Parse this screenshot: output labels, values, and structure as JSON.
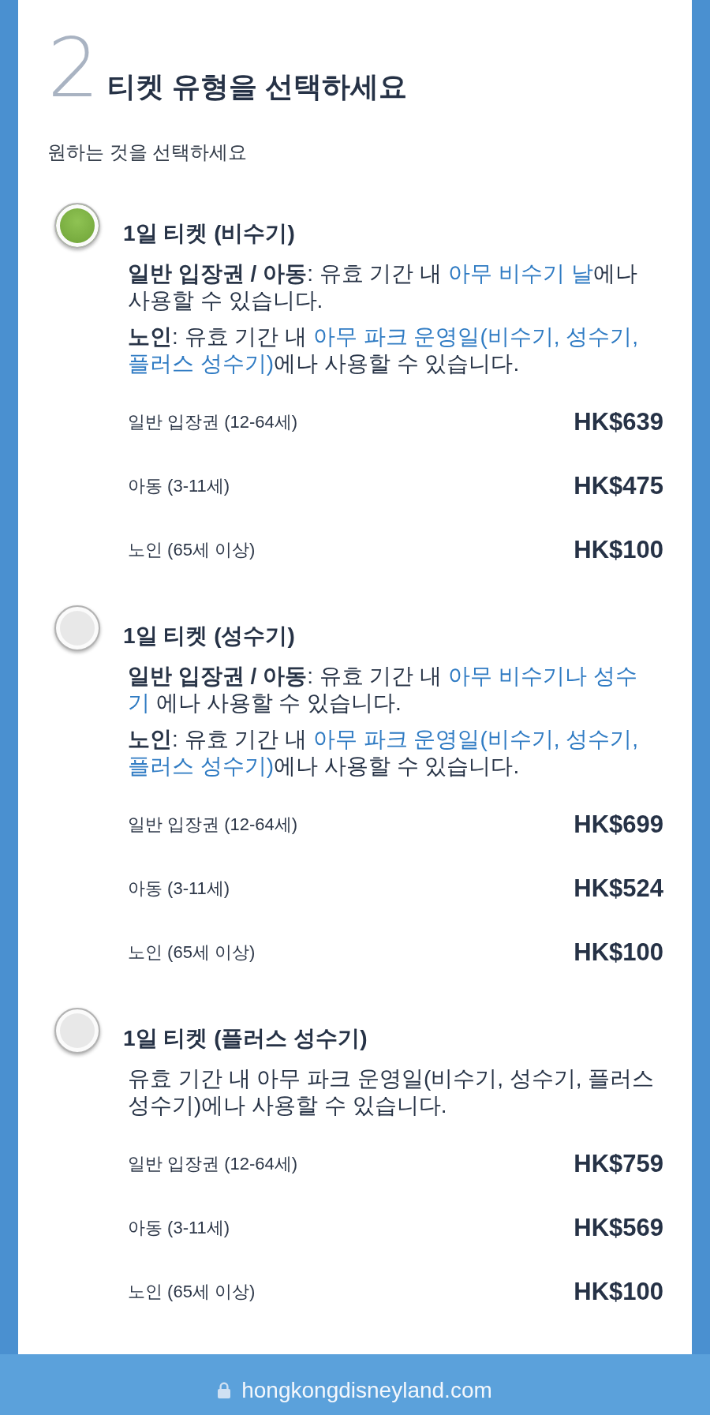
{
  "step": {
    "number": "2",
    "title": "티켓 유형을 선택하세요"
  },
  "instruction": "원하는 것을 선택하세요",
  "options": [
    {
      "title": "1일 티켓 (비수기)",
      "selected": true,
      "descriptions": [
        {
          "lines": [
            [
              {
                "kind": "text",
                "text": "**일반 입장권 / 아동**: 유효 기간 내 "
              },
              {
                "kind": "link",
                "text": "아무 비수기 날"
              },
              {
                "kind": "text",
                "text": "에나"
              }
            ],
            [
              {
                "kind": "text",
                "text": "사용할 수 있습니다."
              }
            ]
          ]
        },
        {
          "lines": [
            [
              {
                "kind": "text",
                "text": "**노인**: 유효 기간 내 "
              },
              {
                "kind": "link",
                "text": "아무 파크 운영일(비수기, 성수기,"
              }
            ],
            [
              {
                "kind": "link",
                "text": "플러스 성수기)"
              },
              {
                "kind": "text",
                "text": "에나 사용할 수 있습니다."
              }
            ]
          ]
        }
      ],
      "prices": [
        {
          "label": "일반 입장권 (12-64세)",
          "price": "HK$639"
        },
        {
          "label": "아동 (3-11세)",
          "price": "HK$475"
        },
        {
          "label": "노인 (65세 이상)",
          "price": "HK$100"
        }
      ]
    },
    {
      "title": "1일 티켓 (성수기)",
      "selected": false,
      "descriptions": [
        {
          "lines": [
            [
              {
                "kind": "text",
                "text": "**일반 입장권 / 아동**: 유효 기간 내 "
              },
              {
                "kind": "link",
                "text": "아무 비수기나 성수"
              }
            ],
            [
              {
                "kind": "link",
                "text": "기"
              },
              {
                "kind": "text",
                "text": " 에나 사용할 수 있습니다."
              }
            ]
          ]
        },
        {
          "lines": [
            [
              {
                "kind": "text",
                "text": "**노인**: 유효 기간 내 "
              },
              {
                "kind": "link",
                "text": "아무 파크 운영일(비수기, 성수기,"
              }
            ],
            [
              {
                "kind": "link",
                "text": "플러스 성수기)"
              },
              {
                "kind": "text",
                "text": "에나 사용할 수 있습니다."
              }
            ]
          ]
        }
      ],
      "prices": [
        {
          "label": "일반 입장권 (12-64세)",
          "price": "HK$699"
        },
        {
          "label": "아동 (3-11세)",
          "price": "HK$524"
        },
        {
          "label": "노인 (65세 이상)",
          "price": "HK$100"
        }
      ]
    },
    {
      "title": "1일 티켓 (플러스 성수기)",
      "selected": false,
      "descriptions": [
        {
          "lines": [
            [
              {
                "kind": "text",
                "text": "유효 기간 내 아무 파크 운영일(비수기, 성수기, 플러스"
              }
            ],
            [
              {
                "kind": "text",
                "text": "성수기)에나 사용할 수 있습니다."
              }
            ]
          ]
        }
      ],
      "prices": [
        {
          "label": "일반 입장권 (12-64세)",
          "price": "HK$759"
        },
        {
          "label": "아동 (3-11세)",
          "price": "HK$569"
        },
        {
          "label": "노인 (65세 이상)",
          "price": "HK$100"
        }
      ]
    }
  ],
  "address_bar": {
    "url": "hongkongdisneyland.com"
  }
}
